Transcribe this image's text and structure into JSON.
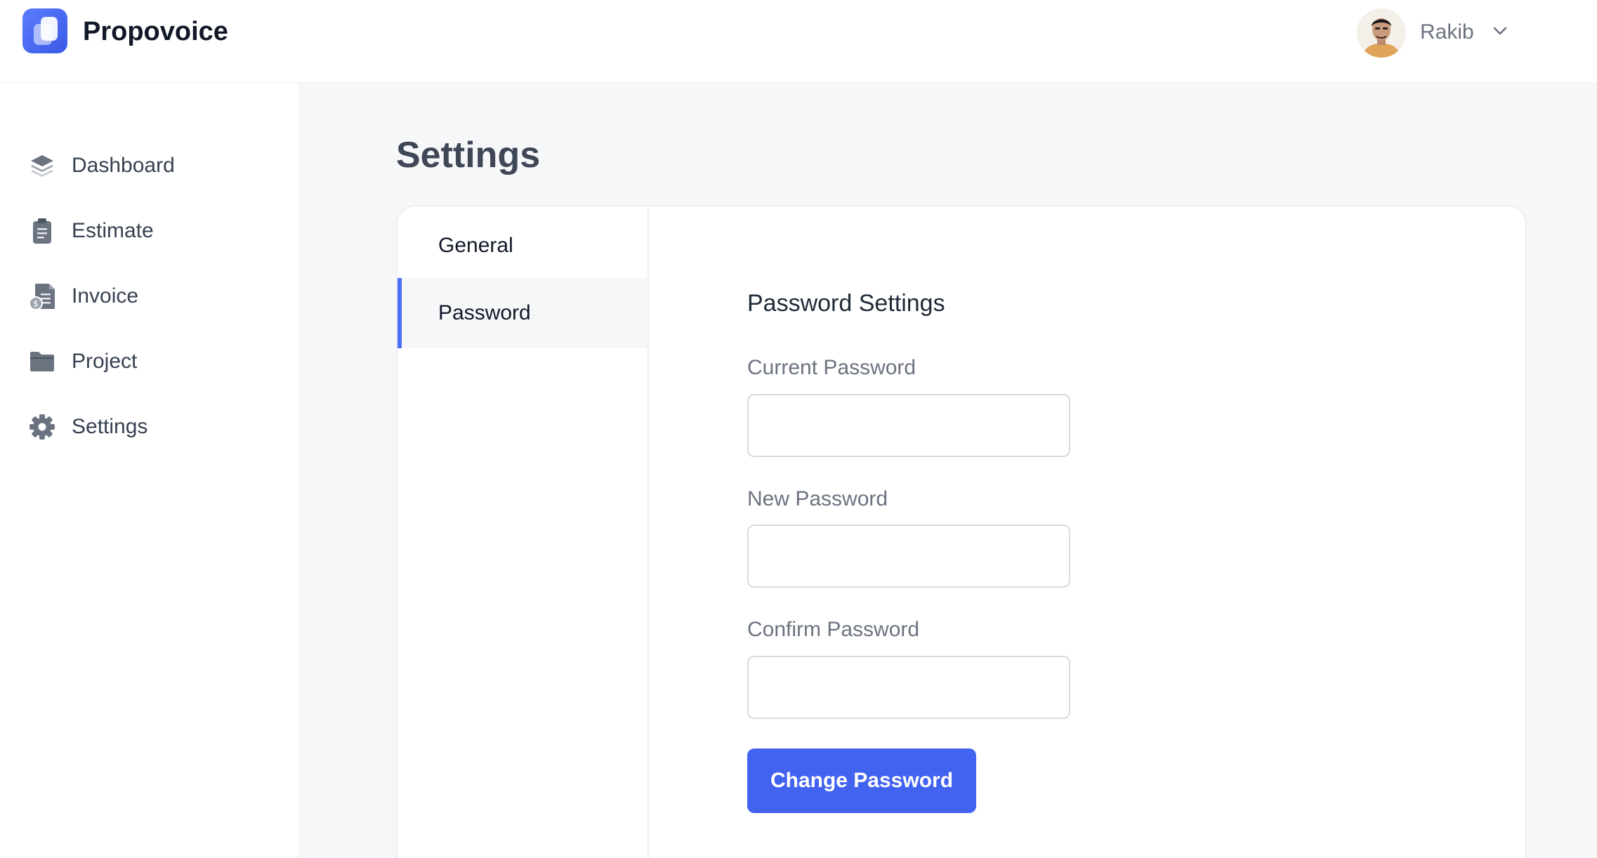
{
  "app": {
    "name": "Propovoice"
  },
  "user": {
    "name": "Rakib"
  },
  "sidebar": {
    "items": [
      {
        "label": "Dashboard",
        "icon": "layers-icon"
      },
      {
        "label": "Estimate",
        "icon": "clipboard-icon"
      },
      {
        "label": "Invoice",
        "icon": "invoice-icon"
      },
      {
        "label": "Project",
        "icon": "folder-icon"
      },
      {
        "label": "Settings",
        "icon": "gear-icon"
      }
    ]
  },
  "page": {
    "title": "Settings"
  },
  "tabs": [
    {
      "label": "General",
      "active": false
    },
    {
      "label": "Password",
      "active": true
    }
  ],
  "password_form": {
    "title": "Password Settings",
    "current_label": "Current Password",
    "current_value": "",
    "new_label": "New Password",
    "new_value": "",
    "confirm_label": "Confirm Password",
    "confirm_value": "",
    "submit_label": "Change Password"
  },
  "colors": {
    "accent": "#4262f0",
    "page_bg": "#f6f7f9",
    "text_muted": "#6b7280"
  }
}
